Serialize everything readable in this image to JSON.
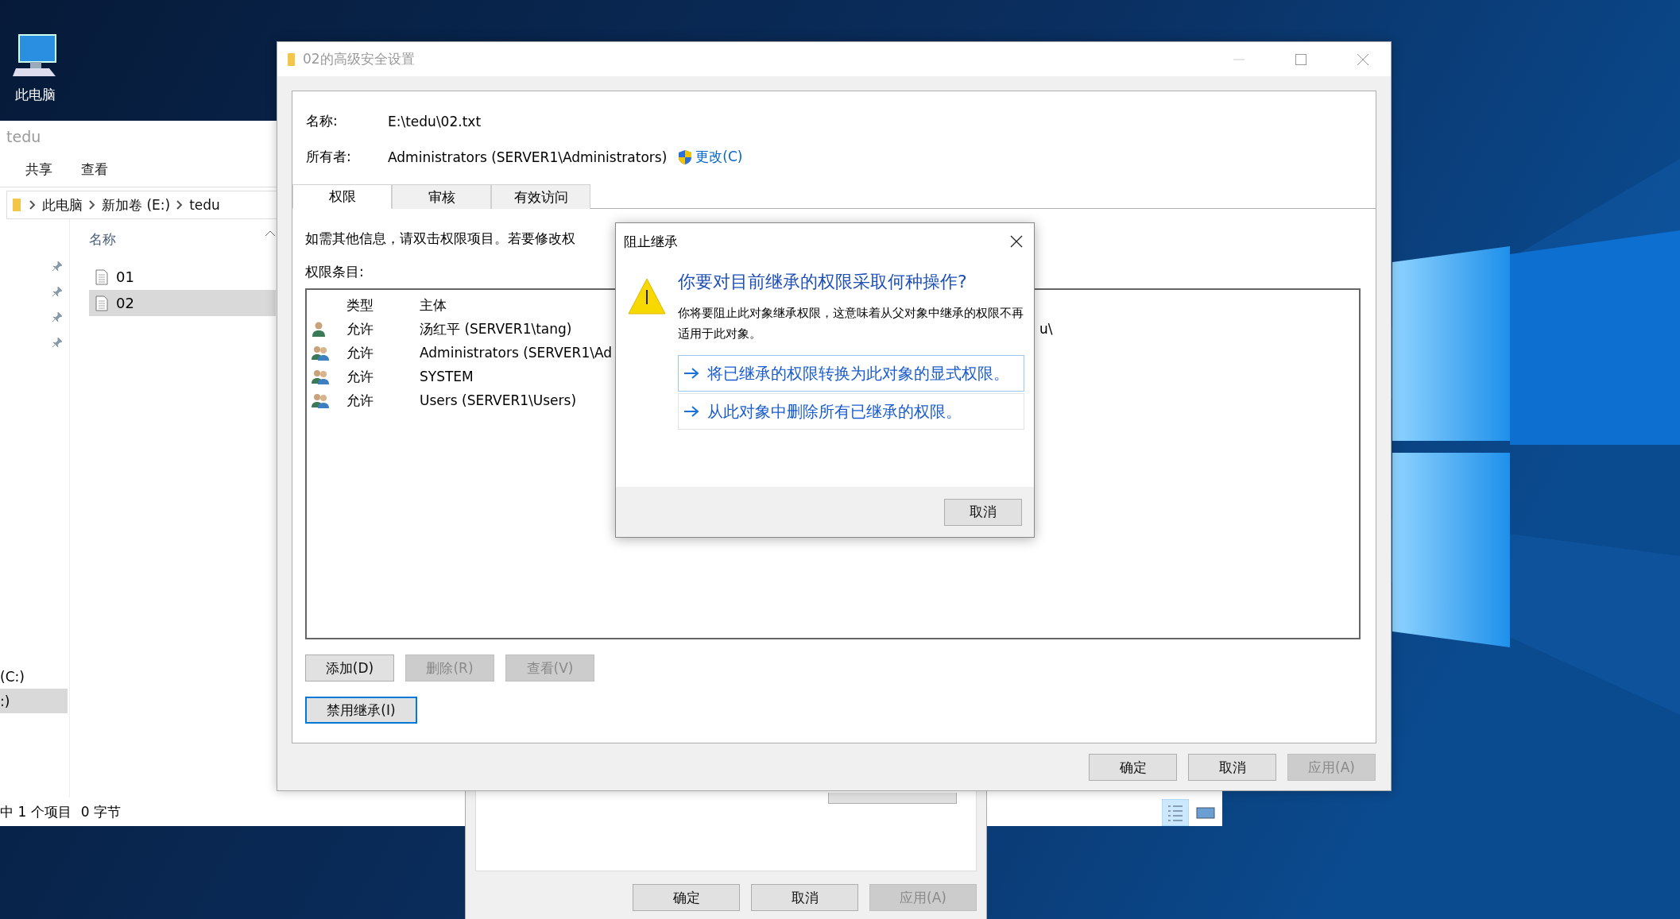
{
  "desktop": {
    "icons": [
      {
        "label": "此电脑"
      }
    ]
  },
  "explorer": {
    "title": "tedu",
    "ribbon_tabs": [
      "共享",
      "查看"
    ],
    "breadcrumb": [
      "此电脑",
      "新加卷 (E:)",
      "tedu"
    ],
    "column_header": "名称",
    "files": [
      {
        "name": "01",
        "selected": false
      },
      {
        "name": "02",
        "selected": true
      }
    ],
    "nav_items": [
      {
        "label": "(C:)",
        "selected": false
      },
      {
        "label": ":)",
        "selected": true
      }
    ],
    "status": "中 1 个项目",
    "size": "0 字节"
  },
  "properties": {
    "buttons": [
      {
        "label": "确定",
        "disabled": false
      },
      {
        "label": "取消",
        "disabled": false
      },
      {
        "label": "应用(A)",
        "disabled": true
      }
    ]
  },
  "security": {
    "title": "02的高级安全设置",
    "name_label": "名称:",
    "name_value": "E:\\tedu\\02.txt",
    "owner_label": "所有者:",
    "owner_value": "Administrators (SERVER1\\Administrators)",
    "change_link": "更改(C)",
    "tabs": [
      {
        "label": "权限",
        "selected": true
      },
      {
        "label": "审核",
        "selected": false
      },
      {
        "label": "有效访问",
        "selected": false
      }
    ],
    "info": "如需其他信息，请双击权限项目。若要修改权",
    "entries_label": "权限条目:",
    "columns": [
      "类型",
      "主体"
    ],
    "entries": [
      {
        "kind": "user",
        "type": "允许",
        "principal": "汤红平 (SERVER1\\tang)",
        "column_3": "u\\"
      },
      {
        "kind": "group",
        "type": "允许",
        "principal": "Administrators (SERVER1\\Ad"
      },
      {
        "kind": "group",
        "type": "允许",
        "principal": "SYSTEM"
      },
      {
        "kind": "group",
        "type": "允许",
        "principal": "Users (SERVER1\\Users)"
      }
    ],
    "buttons": [
      {
        "label": "添加(D)",
        "disabled": false
      },
      {
        "label": "删除(R)",
        "disabled": true
      },
      {
        "label": "查看(V)",
        "disabled": true
      }
    ],
    "inheritance_button": "禁用继承(I)",
    "footer_buttons": [
      {
        "label": "确定",
        "disabled": false
      },
      {
        "label": "取消",
        "disabled": false
      },
      {
        "label": "应用(A)",
        "disabled": true
      }
    ]
  },
  "modal": {
    "title": "阻止继承",
    "heading": "你要对目前继承的权限采取何种操作?",
    "body": "你将要阻止此对象继承权限，这意味着从父对象中继承的权限不再适用于此对象。",
    "options": [
      {
        "label": "将已继承的权限转换为此对象的显式权限。",
        "hovered": true
      },
      {
        "label": "从此对象中删除所有已继承的权限。",
        "hovered": false
      }
    ],
    "cancel": "取消"
  }
}
